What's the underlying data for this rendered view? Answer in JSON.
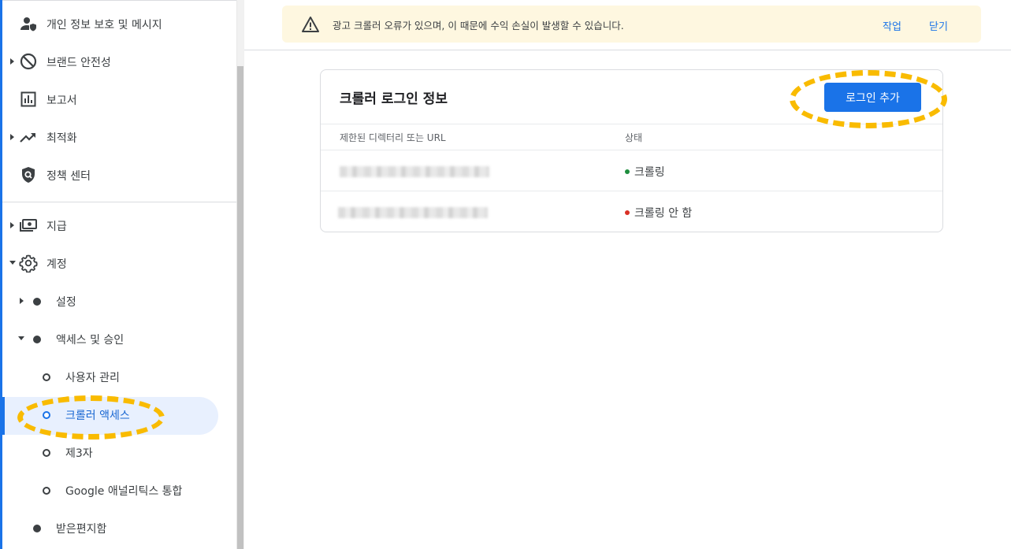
{
  "sidebar": {
    "items": [
      {
        "label": "개인 정보 보호 및 메시지",
        "icon": "person-shield-icon"
      },
      {
        "label": "브랜드 안전성",
        "icon": "block-icon"
      },
      {
        "label": "보고서",
        "icon": "bar-chart-icon"
      },
      {
        "label": "최적화",
        "icon": "trending-up-icon"
      },
      {
        "label": "정책 센터",
        "icon": "policy-shield-icon"
      },
      {
        "label": "지급",
        "icon": "payments-icon"
      },
      {
        "label": "계정",
        "icon": "gear-icon"
      }
    ],
    "account_sub": {
      "settings": "설정",
      "access": "액세스 및 승인",
      "user_management": "사용자 관리",
      "crawler_access": "크롤러 액세스",
      "third_party": "제3자",
      "analytics": "Google 애널리틱스 통합",
      "inbox": "받은편지함"
    }
  },
  "warning": {
    "icon": "warning-icon",
    "text": "광고 크롤러 오류가 있으며, 이 때문에 수익 손실이 발생할 수 있습니다.",
    "action_label": "작업",
    "close_label": "닫기"
  },
  "card": {
    "title": "크롤러 로그인 정보",
    "add_button": "로그인 추가",
    "columns": [
      "제한된 디렉터리 또는 URL",
      "상태"
    ],
    "rows": [
      {
        "status": "크롤링",
        "status_color": "#1e8e3e"
      },
      {
        "status": "크롤링 안 함",
        "status_color": "#d93025"
      }
    ]
  },
  "colors": {
    "accent": "#1a73e8",
    "highlight": "#f9bb00",
    "active_bg": "#e8f0fe",
    "warning_bg": "#fef7e0"
  }
}
